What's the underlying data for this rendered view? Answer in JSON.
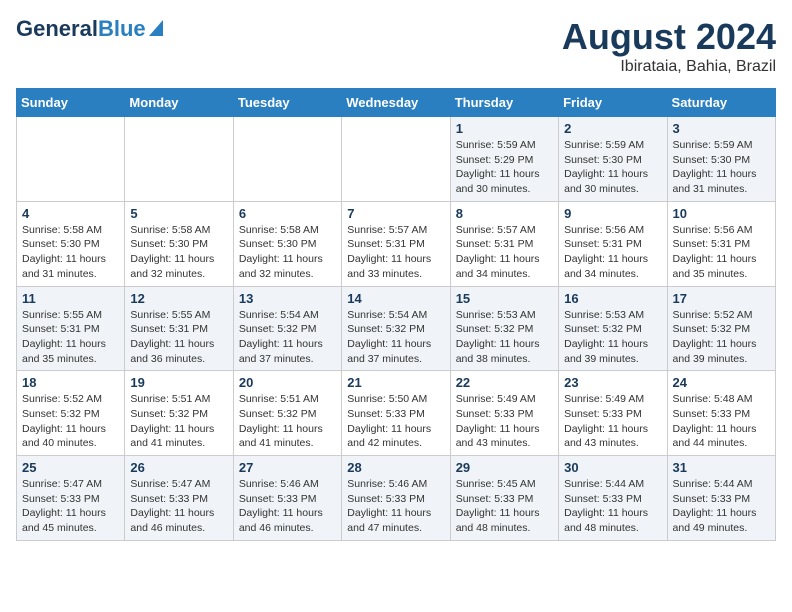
{
  "header": {
    "logo_general": "General",
    "logo_blue": "Blue",
    "title": "August 2024",
    "subtitle": "Ibirataia, Bahia, Brazil"
  },
  "weekdays": [
    "Sunday",
    "Monday",
    "Tuesday",
    "Wednesday",
    "Thursday",
    "Friday",
    "Saturday"
  ],
  "weeks": [
    [
      {
        "day": "",
        "info": ""
      },
      {
        "day": "",
        "info": ""
      },
      {
        "day": "",
        "info": ""
      },
      {
        "day": "",
        "info": ""
      },
      {
        "day": "1",
        "info": "Sunrise: 5:59 AM\nSunset: 5:29 PM\nDaylight: 11 hours and 30 minutes."
      },
      {
        "day": "2",
        "info": "Sunrise: 5:59 AM\nSunset: 5:30 PM\nDaylight: 11 hours and 30 minutes."
      },
      {
        "day": "3",
        "info": "Sunrise: 5:59 AM\nSunset: 5:30 PM\nDaylight: 11 hours and 31 minutes."
      }
    ],
    [
      {
        "day": "4",
        "info": "Sunrise: 5:58 AM\nSunset: 5:30 PM\nDaylight: 11 hours and 31 minutes."
      },
      {
        "day": "5",
        "info": "Sunrise: 5:58 AM\nSunset: 5:30 PM\nDaylight: 11 hours and 32 minutes."
      },
      {
        "day": "6",
        "info": "Sunrise: 5:58 AM\nSunset: 5:30 PM\nDaylight: 11 hours and 32 minutes."
      },
      {
        "day": "7",
        "info": "Sunrise: 5:57 AM\nSunset: 5:31 PM\nDaylight: 11 hours and 33 minutes."
      },
      {
        "day": "8",
        "info": "Sunrise: 5:57 AM\nSunset: 5:31 PM\nDaylight: 11 hours and 34 minutes."
      },
      {
        "day": "9",
        "info": "Sunrise: 5:56 AM\nSunset: 5:31 PM\nDaylight: 11 hours and 34 minutes."
      },
      {
        "day": "10",
        "info": "Sunrise: 5:56 AM\nSunset: 5:31 PM\nDaylight: 11 hours and 35 minutes."
      }
    ],
    [
      {
        "day": "11",
        "info": "Sunrise: 5:55 AM\nSunset: 5:31 PM\nDaylight: 11 hours and 35 minutes."
      },
      {
        "day": "12",
        "info": "Sunrise: 5:55 AM\nSunset: 5:31 PM\nDaylight: 11 hours and 36 minutes."
      },
      {
        "day": "13",
        "info": "Sunrise: 5:54 AM\nSunset: 5:32 PM\nDaylight: 11 hours and 37 minutes."
      },
      {
        "day": "14",
        "info": "Sunrise: 5:54 AM\nSunset: 5:32 PM\nDaylight: 11 hours and 37 minutes."
      },
      {
        "day": "15",
        "info": "Sunrise: 5:53 AM\nSunset: 5:32 PM\nDaylight: 11 hours and 38 minutes."
      },
      {
        "day": "16",
        "info": "Sunrise: 5:53 AM\nSunset: 5:32 PM\nDaylight: 11 hours and 39 minutes."
      },
      {
        "day": "17",
        "info": "Sunrise: 5:52 AM\nSunset: 5:32 PM\nDaylight: 11 hours and 39 minutes."
      }
    ],
    [
      {
        "day": "18",
        "info": "Sunrise: 5:52 AM\nSunset: 5:32 PM\nDaylight: 11 hours and 40 minutes."
      },
      {
        "day": "19",
        "info": "Sunrise: 5:51 AM\nSunset: 5:32 PM\nDaylight: 11 hours and 41 minutes."
      },
      {
        "day": "20",
        "info": "Sunrise: 5:51 AM\nSunset: 5:32 PM\nDaylight: 11 hours and 41 minutes."
      },
      {
        "day": "21",
        "info": "Sunrise: 5:50 AM\nSunset: 5:33 PM\nDaylight: 11 hours and 42 minutes."
      },
      {
        "day": "22",
        "info": "Sunrise: 5:49 AM\nSunset: 5:33 PM\nDaylight: 11 hours and 43 minutes."
      },
      {
        "day": "23",
        "info": "Sunrise: 5:49 AM\nSunset: 5:33 PM\nDaylight: 11 hours and 43 minutes."
      },
      {
        "day": "24",
        "info": "Sunrise: 5:48 AM\nSunset: 5:33 PM\nDaylight: 11 hours and 44 minutes."
      }
    ],
    [
      {
        "day": "25",
        "info": "Sunrise: 5:47 AM\nSunset: 5:33 PM\nDaylight: 11 hours and 45 minutes."
      },
      {
        "day": "26",
        "info": "Sunrise: 5:47 AM\nSunset: 5:33 PM\nDaylight: 11 hours and 46 minutes."
      },
      {
        "day": "27",
        "info": "Sunrise: 5:46 AM\nSunset: 5:33 PM\nDaylight: 11 hours and 46 minutes."
      },
      {
        "day": "28",
        "info": "Sunrise: 5:46 AM\nSunset: 5:33 PM\nDaylight: 11 hours and 47 minutes."
      },
      {
        "day": "29",
        "info": "Sunrise: 5:45 AM\nSunset: 5:33 PM\nDaylight: 11 hours and 48 minutes."
      },
      {
        "day": "30",
        "info": "Sunrise: 5:44 AM\nSunset: 5:33 PM\nDaylight: 11 hours and 48 minutes."
      },
      {
        "day": "31",
        "info": "Sunrise: 5:44 AM\nSunset: 5:33 PM\nDaylight: 11 hours and 49 minutes."
      }
    ]
  ]
}
